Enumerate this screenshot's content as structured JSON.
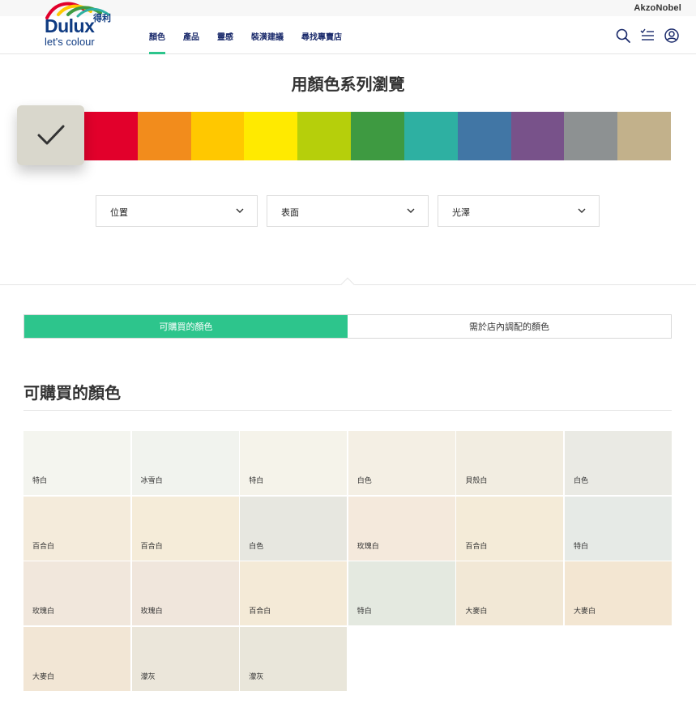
{
  "topbar": {
    "corp": "AkzoNobel"
  },
  "logo": {
    "brand": "Dulux",
    "brand_cn": "得利",
    "tagline": "let's colour"
  },
  "nav": {
    "items": [
      {
        "label": "顏色",
        "active": true
      },
      {
        "label": "產品",
        "active": false
      },
      {
        "label": "靈感",
        "active": false
      },
      {
        "label": "裝潢建議",
        "active": false
      },
      {
        "label": "尋找專賣店",
        "active": false
      }
    ]
  },
  "header_icons": [
    "search-icon",
    "checklist-icon",
    "account-icon"
  ],
  "browse": {
    "title": "用顏色系列瀏覽",
    "selected_color": "#d9d7cc",
    "swatches": [
      "#e2002b",
      "#f28c1c",
      "#ffc800",
      "#ffea00",
      "#b6cf0b",
      "#3e9a41",
      "#2eb0a2",
      "#4176a5",
      "#78528a",
      "#8d9192",
      "#c2b18b"
    ]
  },
  "filters": [
    {
      "label": "位置"
    },
    {
      "label": "表面"
    },
    {
      "label": "光澤"
    }
  ],
  "toggle": {
    "options": [
      {
        "label": "可購買的顏色",
        "active": true
      },
      {
        "label": "需於店內調配的顏色",
        "active": false
      }
    ],
    "accent": "#2dc58c"
  },
  "list": {
    "title": "可購買的顏色",
    "tiles": [
      {
        "name": "特白",
        "color": "#f4f5ef"
      },
      {
        "name": "冰雪白",
        "color": "#f1f3ee"
      },
      {
        "name": "特白",
        "color": "#f5f3ea"
      },
      {
        "name": "白色",
        "color": "#f4efe4"
      },
      {
        "name": "貝殼白",
        "color": "#f2ede1"
      },
      {
        "name": "白色",
        "color": "#eaeae4"
      },
      {
        "name": "百合白",
        "color": "#f4ebdb"
      },
      {
        "name": "百合白",
        "color": "#f5ecd9"
      },
      {
        "name": "白色",
        "color": "#e7e7e0"
      },
      {
        "name": "玫瑰白",
        "color": "#f4e9dc"
      },
      {
        "name": "百合白",
        "color": "#f4ebd8"
      },
      {
        "name": "特白",
        "color": "#e6eae6"
      },
      {
        "name": "玫瑰白",
        "color": "#f1e7dc"
      },
      {
        "name": "玫瑰白",
        "color": "#f0e6dc"
      },
      {
        "name": "百合白",
        "color": "#f4ead7"
      },
      {
        "name": "特白",
        "color": "#e4e9e0"
      },
      {
        "name": "大麥白",
        "color": "#f2e8d6"
      },
      {
        "name": "大麥白",
        "color": "#f3e6d2"
      },
      {
        "name": "大麥白",
        "color": "#f2e6d5"
      },
      {
        "name": "濛灰",
        "color": "#ebe6da"
      },
      {
        "name": "濛灰",
        "color": "#e9e6da"
      }
    ]
  }
}
